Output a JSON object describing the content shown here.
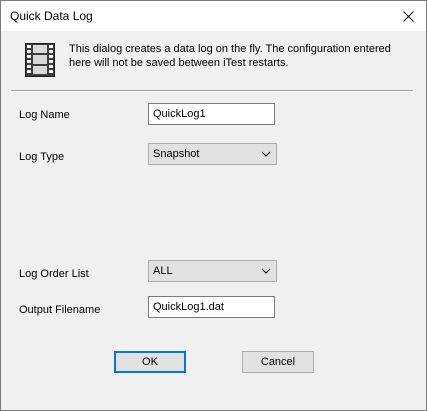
{
  "window": {
    "title": "Quick Data Log",
    "close_icon": "close-icon"
  },
  "info": {
    "icon": "film-strip-icon",
    "text": "This dialog creates a data log on the fly. The configuration entered here will not be saved between iTest restarts."
  },
  "form": {
    "log_name": {
      "label": "Log Name",
      "value": "QuickLog1"
    },
    "log_type": {
      "label": "Log Type",
      "selected": "Snapshot"
    },
    "log_order_list": {
      "label": "Log Order List",
      "selected": "ALL"
    },
    "output_filename": {
      "label": "Output Filename",
      "value": "QuickLog1.dat"
    }
  },
  "buttons": {
    "ok": "OK",
    "cancel": "Cancel"
  }
}
